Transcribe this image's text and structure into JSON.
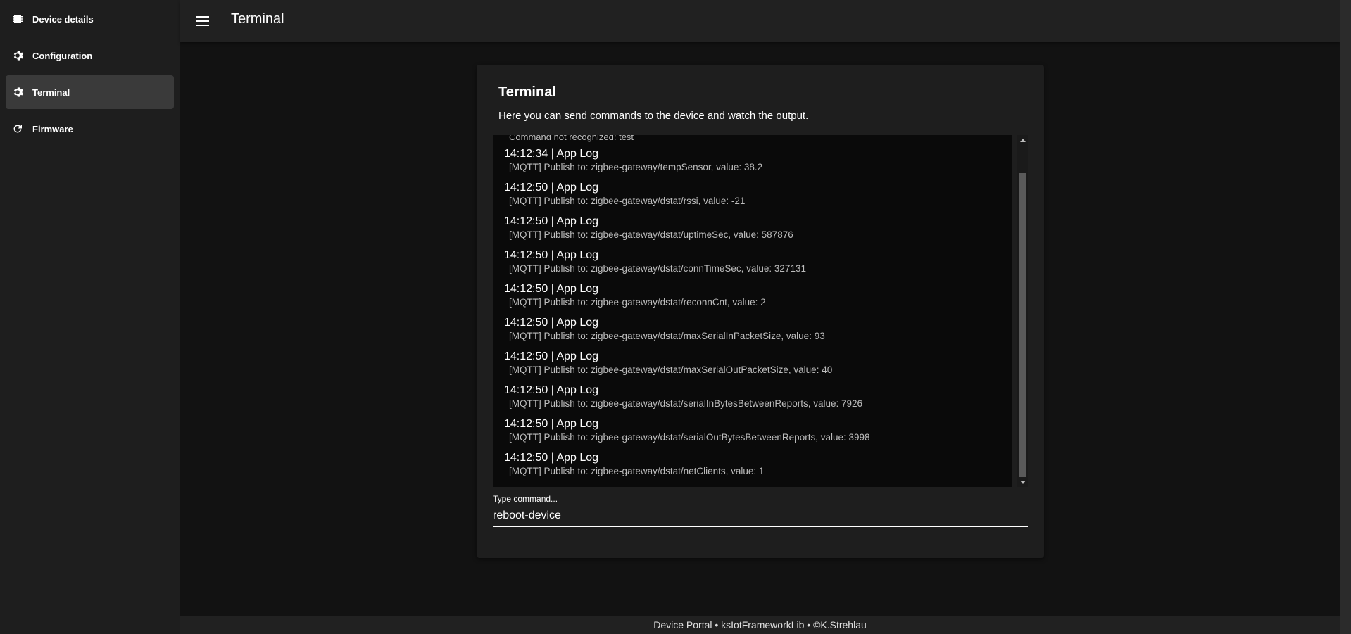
{
  "sidebar": {
    "items": [
      {
        "label": "Device details",
        "icon": "chip-icon",
        "active": false
      },
      {
        "label": "Configuration",
        "icon": "gear-icon",
        "active": false
      },
      {
        "label": "Terminal",
        "icon": "gear-icon",
        "active": true
      },
      {
        "label": "Firmware",
        "icon": "refresh-icon",
        "active": false
      }
    ]
  },
  "header": {
    "title": "Terminal",
    "menu_icon": "hamburger-menu-icon"
  },
  "card": {
    "title": "Terminal",
    "subtitle": "Here you can send commands to the device and watch the output.",
    "partial_line": "Command not recognized: test",
    "log": [
      {
        "head": "14:12:34 | App Log",
        "msg": "[MQTT] Publish to: zigbee-gateway/tempSensor, value: 38.2"
      },
      {
        "head": "14:12:50 | App Log",
        "msg": "[MQTT] Publish to: zigbee-gateway/dstat/rssi, value: -21"
      },
      {
        "head": "14:12:50 | App Log",
        "msg": "[MQTT] Publish to: zigbee-gateway/dstat/uptimeSec, value: 587876"
      },
      {
        "head": "14:12:50 | App Log",
        "msg": "[MQTT] Publish to: zigbee-gateway/dstat/connTimeSec, value: 327131"
      },
      {
        "head": "14:12:50 | App Log",
        "msg": "[MQTT] Publish to: zigbee-gateway/dstat/reconnCnt, value: 2"
      },
      {
        "head": "14:12:50 | App Log",
        "msg": "[MQTT] Publish to: zigbee-gateway/dstat/maxSerialInPacketSize, value: 93"
      },
      {
        "head": "14:12:50 | App Log",
        "msg": "[MQTT] Publish to: zigbee-gateway/dstat/maxSerialOutPacketSize, value: 40"
      },
      {
        "head": "14:12:50 | App Log",
        "msg": "[MQTT] Publish to: zigbee-gateway/dstat/serialInBytesBetweenReports, value: 7926"
      },
      {
        "head": "14:12:50 | App Log",
        "msg": "[MQTT] Publish to: zigbee-gateway/dstat/serialOutBytesBetweenReports, value: 3998"
      },
      {
        "head": "14:12:50 | App Log",
        "msg": "[MQTT] Publish to: zigbee-gateway/dstat/netClients, value: 1"
      }
    ],
    "command": {
      "label": "Type command...",
      "value": "reboot-device"
    }
  },
  "footer": {
    "text": "Device Portal • ksIotFrameworkLib • ©K.Strehlau"
  }
}
